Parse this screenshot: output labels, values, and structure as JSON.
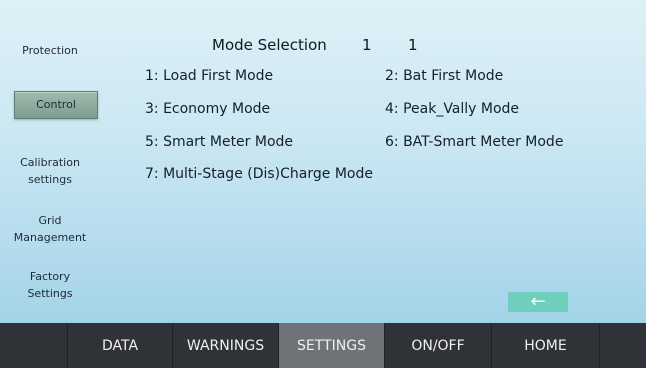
{
  "sidebar": {
    "items": [
      {
        "label": "Protection"
      },
      {
        "label": "Control",
        "active": true
      },
      {
        "label_line1": "Calibration",
        "label_line2": "settings"
      },
      {
        "label_line1": "Grid",
        "label_line2": "Management"
      },
      {
        "label_line1": "Factory",
        "label_line2": "Settings"
      }
    ]
  },
  "main": {
    "title": "Mode Selection",
    "current_value": "1",
    "selected_value": "1",
    "modes": [
      "1: Load First Mode",
      "2: Bat First Mode",
      "3: Economy Mode",
      "4: Peak_Vally Mode",
      "5: Smart Meter Mode",
      "6: BAT-Smart Meter Mode",
      "7: Multi-Stage (Dis)Charge Mode"
    ],
    "back_icon": "arrow-left-icon"
  },
  "bottom_nav": {
    "tabs": [
      {
        "label": "DATA"
      },
      {
        "label": "WARNINGS"
      },
      {
        "label": "SETTINGS",
        "active": true
      },
      {
        "label": "ON/OFF"
      },
      {
        "label": "HOME"
      }
    ]
  },
  "colors": {
    "active_sidebar": "#8fad9f",
    "back_button": "#6ecfbd",
    "nav_bg": "#2f3236",
    "nav_active": "#6f7377"
  }
}
